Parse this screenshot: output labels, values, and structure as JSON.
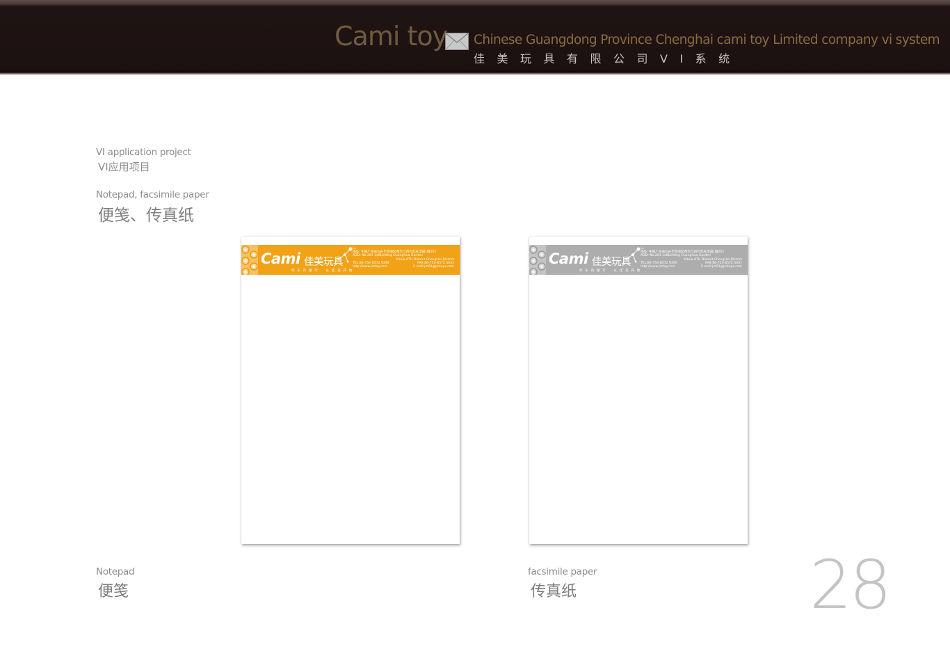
{
  "header": {
    "brand": "Cami toy",
    "envelope_icon": "envelope-icon",
    "tagline_en": "Chinese Guangdong Province Chenghai cami toy Limited company vi system",
    "tagline_cn": "佳美玩具有限公司VI系统"
  },
  "section": {
    "category_en": "VI application project",
    "category_cn": "VI应用项目",
    "title_en": "Notepad, facsimile paper",
    "title_cn": "便笺、传真纸"
  },
  "sheets": [
    {
      "id": "notepad",
      "caption_en": "Notepad",
      "caption_cn": "便笺",
      "color": "#f2a217"
    },
    {
      "id": "fax",
      "caption_en": "facsimile paper",
      "caption_cn": "传真纸",
      "color": "#adadad"
    }
  ],
  "letterhead": {
    "logo_word": "Cami",
    "logo_cn": "佳美玩具",
    "trademark": "TM",
    "slogan": "欢 乐 的 童 年    从 佳 美 开 始",
    "address_cn": "地址: 中国广东省汕头市澄海区西华六四片区光华园1幢201",
    "address_en_1": "ADD: No.201 1stBuilding GuangHua Garden",
    "address_en_2": "XiHua 6TH District,ChengHai District",
    "tel": "TEL:86-754-8572 9359",
    "fax": "FAX:86-754-8572 5031",
    "web": "http://www.jmtoy.com",
    "email": "E-mail:jm01@jmtoys.com"
  },
  "page_number": "28"
}
